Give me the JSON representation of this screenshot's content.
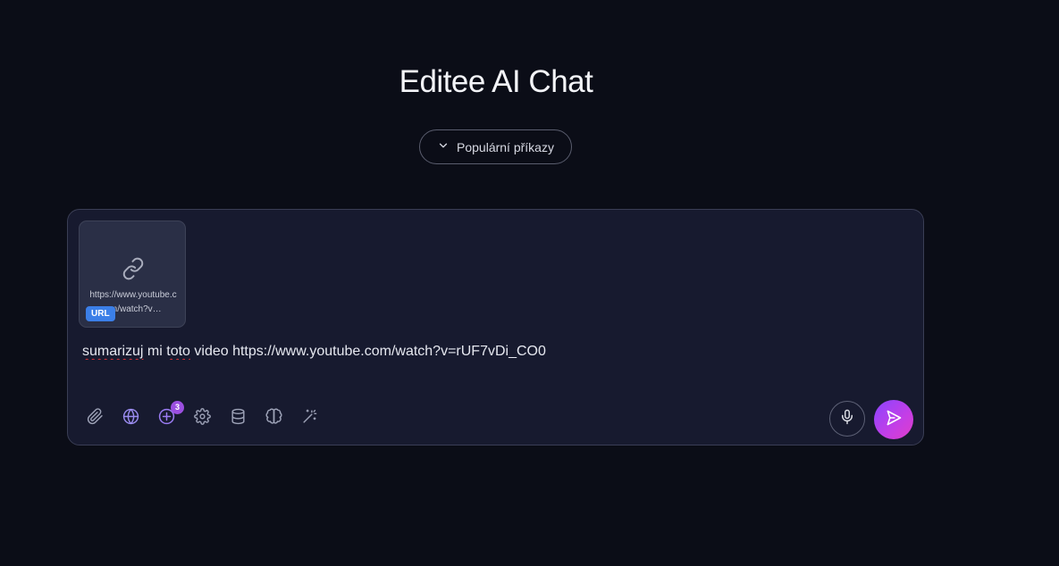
{
  "header": {
    "title": "Editee AI Chat"
  },
  "popular_commands": {
    "label": "Populární příkazy",
    "icon": "chevron-down-icon"
  },
  "composer": {
    "attachment": {
      "icon": "link-icon",
      "url": "https://www.youtube.com/watch?v…",
      "type_badge": "URL"
    },
    "message": {
      "word_1": "sumarizuj",
      "part_2": " mi ",
      "word_3": "toto",
      "part_4": " video https://www.youtube.com/watch?v=rUF7vDi_CO0"
    },
    "toolbar": [
      {
        "icon": "paperclip-icon"
      },
      {
        "icon": "globe-icon"
      },
      {
        "icon": "plus-circle-icon",
        "badge": "3"
      },
      {
        "icon": "gear-icon"
      },
      {
        "icon": "database-icon"
      },
      {
        "icon": "brain-icon"
      },
      {
        "icon": "magic-wand-icon"
      }
    ],
    "mic_icon": "microphone-icon",
    "send_icon": "send-icon"
  },
  "colors": {
    "background": "#0b0d17",
    "composer_bg": "#171a2f",
    "accent_gradient_start": "#8a45ff",
    "accent_gradient_end": "#e03ec8",
    "url_badge": "#3b7fe8",
    "count_badge": "#9b4fe0"
  }
}
